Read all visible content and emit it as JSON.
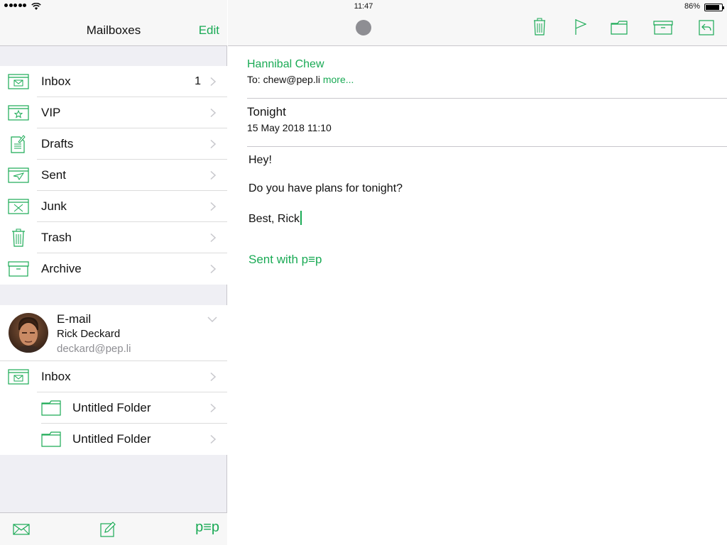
{
  "status_bar": {
    "time": "11:47",
    "battery": "86%",
    "battery_level": 0.86
  },
  "left": {
    "title": "Mailboxes",
    "edit_label": "Edit",
    "mailboxes": [
      {
        "label": "Inbox",
        "count": "1",
        "icon": "inbox-icon"
      },
      {
        "label": "VIP",
        "count": "",
        "icon": "vip-star-icon"
      },
      {
        "label": "Drafts",
        "count": "",
        "icon": "drafts-icon"
      },
      {
        "label": "Sent",
        "count": "",
        "icon": "sent-icon"
      },
      {
        "label": "Junk",
        "count": "",
        "icon": "junk-icon"
      },
      {
        "label": "Trash",
        "count": "",
        "icon": "trash-icon"
      },
      {
        "label": "Archive",
        "count": "",
        "icon": "archive-icon"
      }
    ],
    "account": {
      "type": "E-mail",
      "name": "Rick Deckard",
      "email": "deckard@pep.li",
      "folders": [
        {
          "label": "Inbox",
          "icon": "inbox-icon"
        },
        {
          "label": "Untitled Folder",
          "icon": "folder-icon"
        },
        {
          "label": "Untitled Folder",
          "icon": "folder-icon"
        }
      ]
    },
    "toolbar": {
      "pep_label": "p≡p"
    }
  },
  "message": {
    "from": "Hannibal Chew",
    "to_prefix": "To: ",
    "to": "chew@pep.li",
    "more": "more...",
    "subject": "Tonight",
    "date": "15 May 2018 11:10",
    "body": [
      "Hey!",
      "Do you have plans for tonight?",
      "Best, Rick"
    ],
    "signature": "Sent with p≡p"
  },
  "colors": {
    "accent": "#1aaa55",
    "status_dot": "#8e8e93"
  }
}
